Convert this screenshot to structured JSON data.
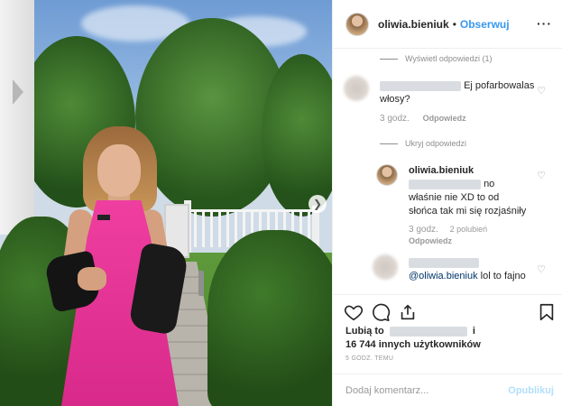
{
  "post": {
    "username": "oliwia.bieniuk",
    "follow_label": "Obserwuj",
    "more_icon": "more-options-icon"
  },
  "comments": {
    "show_replies": "Wyświetl odpowiedzi (1)",
    "hide_replies": "Ukryj odpowiedzi",
    "c1": {
      "text_a": "Ej pofarbowalas",
      "text_b": "włosy?",
      "time": "3 godz.",
      "reply": "Odpowiedz"
    },
    "c2": {
      "username": "oliwia.bieniuk",
      "text_a": "no",
      "text_b": "właśnie nie XD to od",
      "text_c": "słońca tak mi się rozjaśniły",
      "time": "3 godz.",
      "likes": "2 polubień",
      "reply": "Odpowiedz"
    },
    "c3": {
      "mention": "@oliwia.bieniuk",
      "text": " lol to fajno"
    }
  },
  "likes": {
    "prefix": "Lubią to",
    "suffix": "i",
    "others": "16 744 innych użytkowników"
  },
  "timestamp": "5 GODZ. TEMU",
  "add_comment": {
    "placeholder": "Dodaj komentarz...",
    "publish_label": "Opublikuj"
  },
  "colors": {
    "accent": "#3897f0",
    "publish_disabled": "#b2dffc",
    "dress": "#e8368f"
  }
}
